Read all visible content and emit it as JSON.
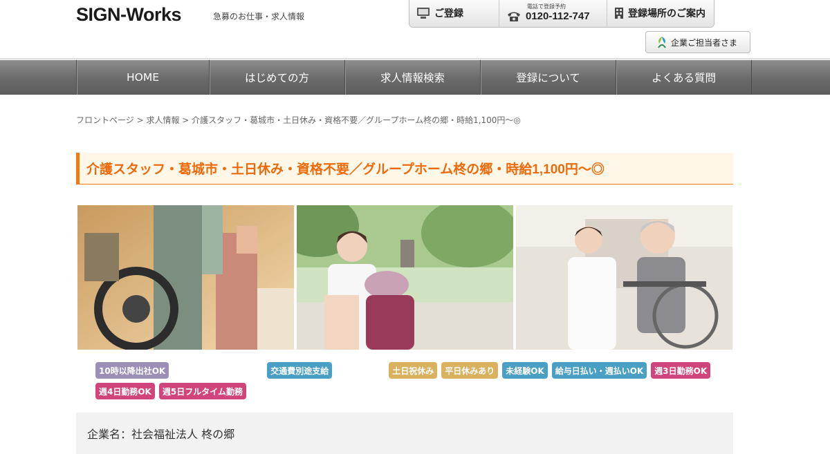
{
  "header": {
    "logo": "SIGN-Works",
    "tagline": "急募のお仕事・求人情報",
    "buttons": {
      "register": "ご登録",
      "tel_small": "電話で登録予約",
      "tel_number": "0120-112-747",
      "locations": "登録場所のご案内"
    },
    "corporate_button": "企業ご担当者さま"
  },
  "nav": {
    "items": [
      {
        "label": "HOME"
      },
      {
        "label": "はじめての方"
      },
      {
        "label": "求人情報検索"
      },
      {
        "label": "登録について"
      },
      {
        "label": "よくある質問"
      }
    ]
  },
  "breadcrumb": {
    "front": "フロントページ",
    "sep": " > ",
    "jobs": "求人情報",
    "current": "介護スタッフ・葛城市・土日休み・資格不要／グループホーム柊の郷・時給1,100円～◎"
  },
  "job": {
    "title": "介護スタッフ・葛城市・土日休み・資格不要／グループホーム柊の郷・時給1,100円～◎",
    "tags_row1": [
      {
        "label": "10時以降出社OK",
        "color": "purple"
      },
      {
        "label": "交通費別途支給",
        "color": "blue"
      },
      {
        "label": "土日祝休み",
        "color": "gold"
      },
      {
        "label": "平日休みあり",
        "color": "gold"
      },
      {
        "label": "未経験OK",
        "color": "blue"
      },
      {
        "label": "給与日払い・週払いOK",
        "color": "blue"
      },
      {
        "label": "週3日勤務OK",
        "color": "pink"
      }
    ],
    "tags_row2": [
      {
        "label": "週4日勤務OK",
        "color": "pink"
      },
      {
        "label": "週5日フルタイム勤務",
        "color": "pink"
      }
    ],
    "company": "企業名：社会福祉法人 柊の郷"
  },
  "colors": {
    "accent_orange": "#ec6a0b",
    "title_bg": "#fff8e8",
    "tag_purple": "#9b8fb8",
    "tag_blue": "#4a9fc4",
    "tag_gold": "#d9b15f",
    "tag_pink": "#d0457b"
  },
  "images": [
    {
      "name": "photo-caregiver-wheelchair-transfer"
    },
    {
      "name": "photo-caregiver-park-wheelchair"
    },
    {
      "name": "photo-caregiver-smiling-senior-wheelchair"
    }
  ]
}
